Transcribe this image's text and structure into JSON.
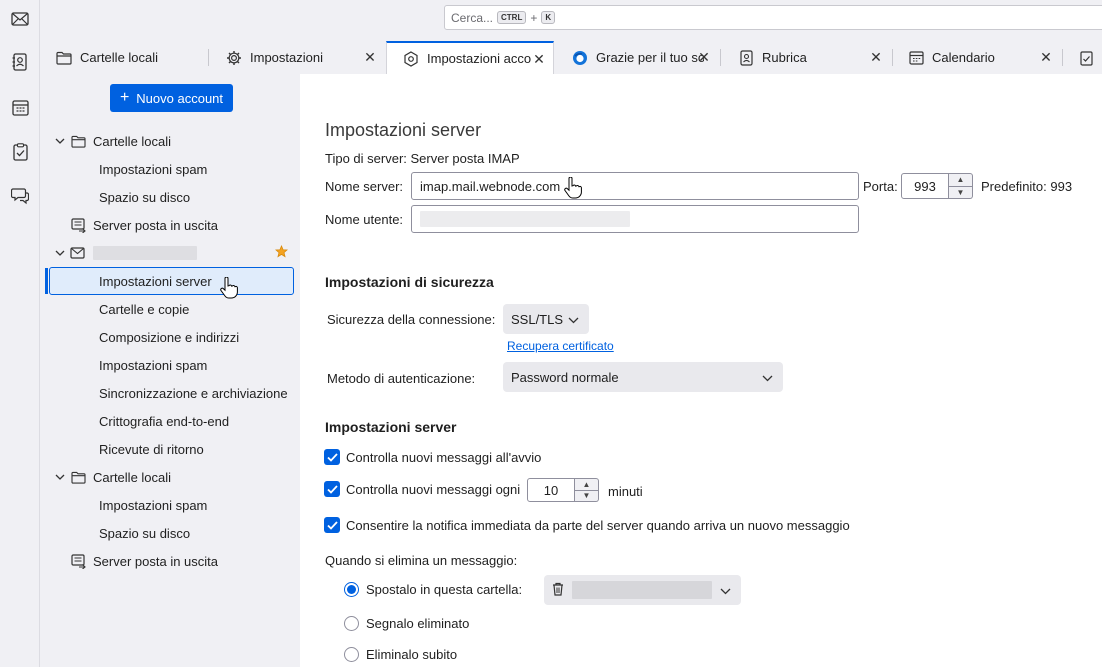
{
  "search": {
    "placeholder": "Cerca...",
    "shortcut_mod": "CTRL",
    "shortcut_plus": "+",
    "shortcut_key": "K"
  },
  "spaces": [
    "mail-icon",
    "address-book-icon",
    "calendar-icon",
    "tasks-icon",
    "chat-icon"
  ],
  "tabs": [
    {
      "label": "Cartelle locali",
      "icon": "folder-icon"
    },
    {
      "label": "Impostazioni",
      "icon": "gear-icon",
      "close": "✕"
    },
    {
      "label": "Impostazioni account",
      "icon": "account-settings-icon",
      "close": "✕"
    },
    {
      "label": "Grazie per il tuo sostegno",
      "icon": "thunderbird-icon",
      "close": "✕"
    },
    {
      "label": "Rubrica",
      "icon": "address-book-icon",
      "close": "✕"
    },
    {
      "label": "Calendario",
      "icon": "calendar-icon",
      "close": "✕"
    },
    {
      "label": "",
      "icon": "tasks-icon"
    }
  ],
  "sidebar": {
    "new_account": "Nuovo account",
    "local1": {
      "label": "Cartelle locali",
      "children": [
        "Impostazioni spam",
        "Spazio su disco"
      ]
    },
    "outgoing1": "Server posta in uscita",
    "account": {
      "children": [
        "Impostazioni server",
        "Cartelle e copie",
        "Composizione e indirizzi",
        "Impostazioni spam",
        "Sincronizzazione e archiviazione",
        "Crittografia end-to-end",
        "Ricevute di ritorno"
      ]
    },
    "local2": {
      "label": "Cartelle locali",
      "children": [
        "Impostazioni spam",
        "Spazio su disco"
      ]
    },
    "outgoing2": "Server posta in uscita"
  },
  "main": {
    "title": "Impostazioni server",
    "server_type_label": "Tipo di server:",
    "server_type_value": "Server posta IMAP",
    "server_name_label": "Nome server:",
    "server_name_value": "imap.mail.webnode.com",
    "port_label": "Porta:",
    "port_value": "993",
    "default_label": "Predefinito: 993",
    "username_label": "Nome utente:",
    "security_heading": "Impostazioni di sicurezza",
    "conn_security_label": "Sicurezza della connessione:",
    "conn_security_value": "SSL/TLS",
    "cert_link": "Recupera certificato",
    "auth_label": "Metodo di autenticazione:",
    "auth_value": "Password normale",
    "server_heading": "Impostazioni server",
    "check_startup": "Controlla nuovi messaggi all'avvio",
    "check_every_pre": "Controlla nuovi messaggi ogni",
    "check_every_value": "10",
    "check_every_post": "minuti",
    "allow_push": "Consentire la notifica immediata da parte del server quando arriva un nuovo messaggio",
    "delete_label": "Quando si elimina un messaggio:",
    "move_label": "Spostalo in questa cartella:",
    "mark_label": "Segnalo eliminato",
    "remove_label": "Eliminalo subito"
  }
}
